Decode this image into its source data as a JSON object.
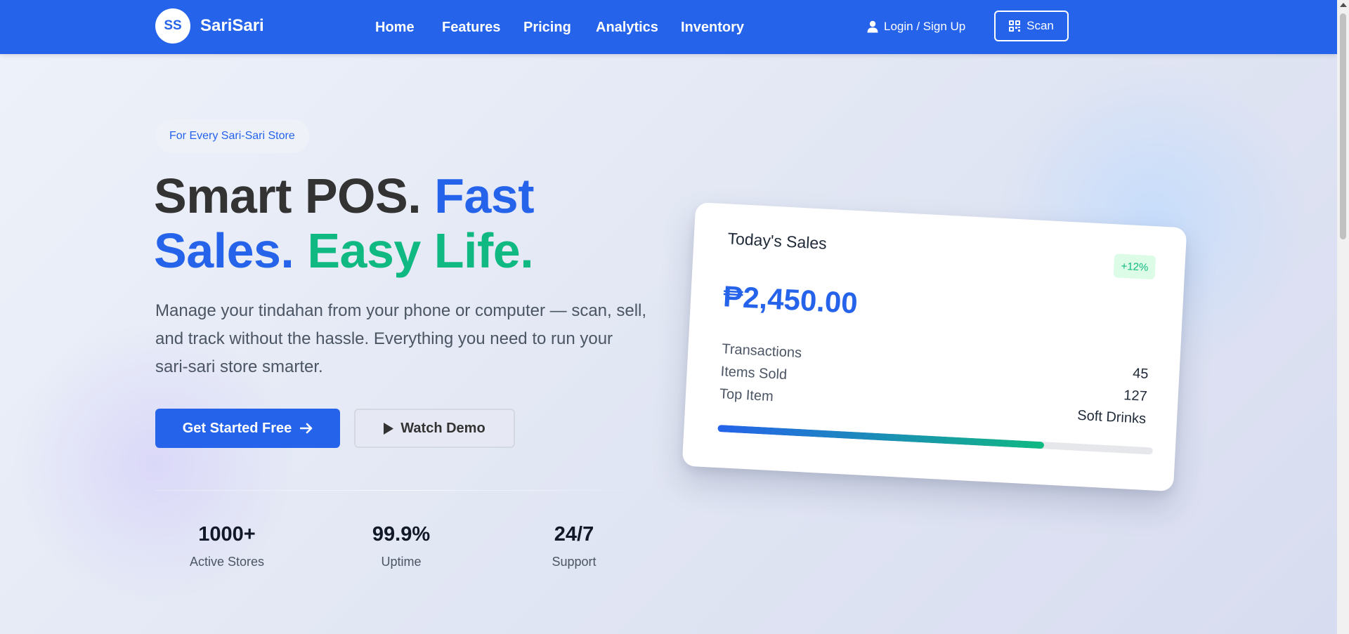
{
  "navbar": {
    "logo_initials": "SS",
    "brand": "SariSari",
    "links": [
      "Home",
      "Features",
      "Pricing",
      "Analytics",
      "Inventory"
    ],
    "login_label": "Login / Sign Up",
    "scan_label": "Scan",
    "color": "#2563eb"
  },
  "hero": {
    "badge": "For Every Sari-Sari Store",
    "title_part1": "Smart POS.",
    "title_part2": "Fast Sales.",
    "title_part3": "Easy Life.",
    "description": "Manage your tindahan from your phone or computer — scan, sell, and track without the hassle. Everything you need to run your sari-sari store smarter.",
    "primary_button": "Get Started Free",
    "secondary_button": "Watch Demo",
    "stats": [
      {
        "value": "1000+",
        "label": "Active Stores"
      },
      {
        "value": "99.9%",
        "label": "Uptime"
      },
      {
        "value": "24/7",
        "label": "Support"
      }
    ]
  },
  "sales_card": {
    "title": "Today's Sales",
    "change_badge": "+12%",
    "amount": "₱2,450.00",
    "labels": [
      "Transactions",
      "Items Sold",
      "Top Item"
    ],
    "values": [
      "45",
      "127",
      "Soft Drinks"
    ],
    "progress": 0.75,
    "colors": {
      "accent": "#2563eb",
      "positive": "#10b981"
    }
  }
}
